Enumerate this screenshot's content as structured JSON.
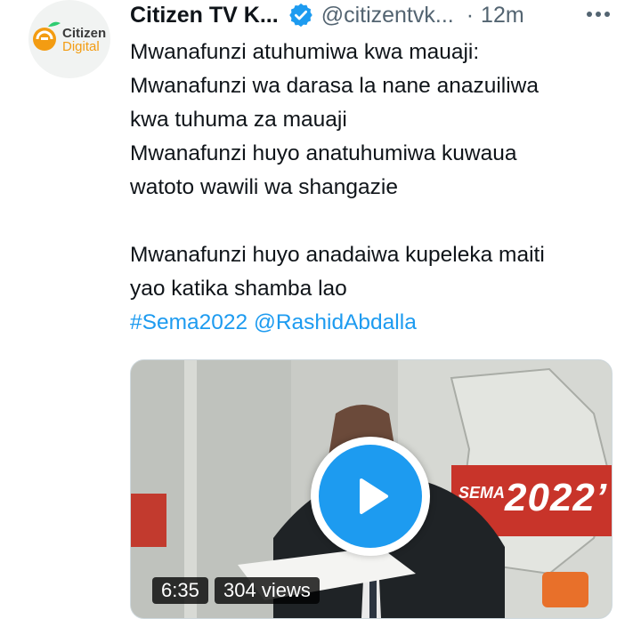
{
  "tweet": {
    "author": {
      "display_name": "Citizen TV K...",
      "handle": "@citizentvk...",
      "verified_icon": "verified-badge-icon",
      "avatar_text_line1": "Citizen",
      "avatar_text_line2": "Digital"
    },
    "separator": "·",
    "timestamp": "12m",
    "more_icon": "more-horizontal-icon",
    "text_lines": [
      "Mwanafunzi atuhumiwa kwa mauaji:",
      "Mwanafunzi wa darasa la nane anazuiliwa",
      "kwa tuhuma za mauaji",
      "Mwanafunzi huyo anatuhumiwa kuwaua",
      "watoto wawili wa shangazie",
      "",
      "Mwanafunzi huyo anadaiwa kupeleka maiti",
      "yao katika shamba lao"
    ],
    "hashtag": "#Sema2022",
    "mention": "@RashidAbdalla",
    "media": {
      "type": "video",
      "duration": "6:35",
      "views": "304 views",
      "graphic_small": "SEMA",
      "graphic_large": "2022’",
      "play_icon": "play-icon"
    },
    "colors": {
      "link": "#1d9bf0",
      "text": "#0f1419",
      "muted": "#536471",
      "play_button": "#1d9bf0"
    }
  }
}
